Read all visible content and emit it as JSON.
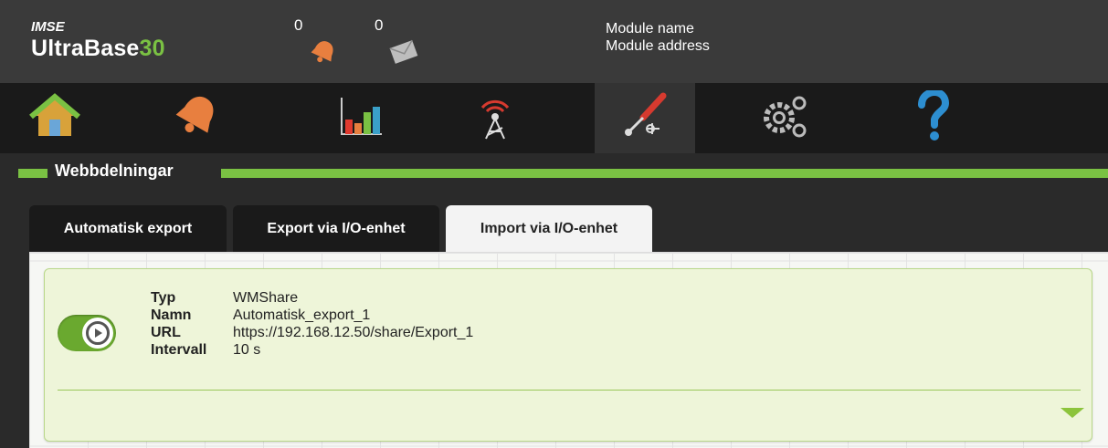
{
  "header": {
    "brand_small": "IMSE",
    "brand_main": "UltraBase",
    "brand_num": "30",
    "alarm_count": "0",
    "message_count": "0",
    "module_name": "Module name",
    "module_address": "Module address"
  },
  "nav": {
    "items": [
      {
        "icon": "home-icon"
      },
      {
        "icon": "bell-icon"
      },
      {
        "icon": "bar-chart-icon"
      },
      {
        "icon": "antenna-icon"
      },
      {
        "icon": "tools-icon",
        "active": true
      },
      {
        "icon": "gears-icon"
      },
      {
        "icon": "help-icon"
      }
    ]
  },
  "section": {
    "title": "Webbdelningar"
  },
  "tabs": [
    {
      "label": "Automatisk export"
    },
    {
      "label": "Export via I/O-enhet"
    },
    {
      "label": "Import via I/O-enhet",
      "active": true
    }
  ],
  "card": {
    "enabled": true,
    "fields": [
      {
        "label": "Typ",
        "value": "WMShare"
      },
      {
        "label": "Namn",
        "value": "Automatisk_export_1"
      },
      {
        "label": "URL",
        "value": "https://192.168.12.50/share/Export_1"
      },
      {
        "label": "Intervall",
        "value": "10 s"
      }
    ]
  },
  "colors": {
    "accent": "#7ac143",
    "header_bg": "#3a3a3a",
    "nav_bg": "#1a1a1a",
    "card_bg": "#eef5d9"
  }
}
